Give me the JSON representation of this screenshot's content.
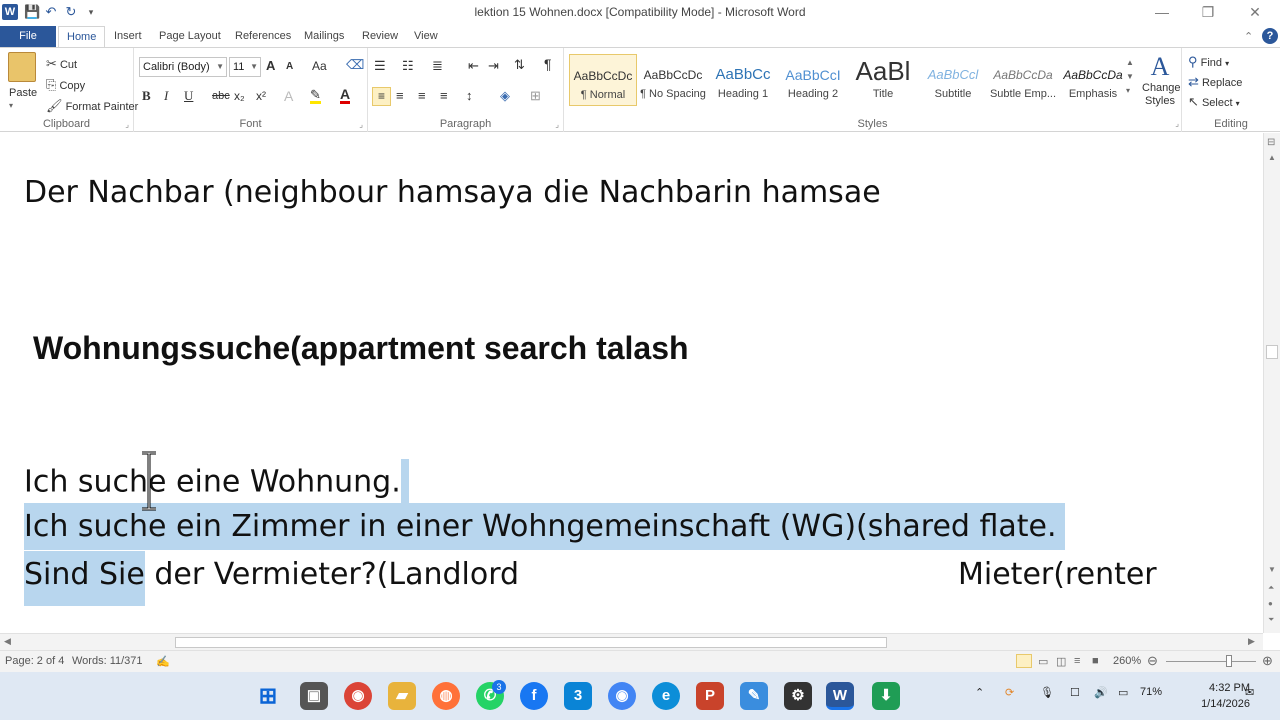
{
  "window": {
    "title": "lektion 15 Wohnen.docx [Compatibility Mode]  -  Microsoft Word",
    "minimize": "—",
    "restore": "❐",
    "close": "✕"
  },
  "tabs": [
    {
      "label": "File"
    },
    {
      "label": "Home"
    },
    {
      "label": "Insert"
    },
    {
      "label": "Page Layout"
    },
    {
      "label": "References"
    },
    {
      "label": "Mailings"
    },
    {
      "label": "Review"
    },
    {
      "label": "View"
    }
  ],
  "ribbon": {
    "clipboard": {
      "label": "Clipboard",
      "paste": "Paste",
      "cut": "Cut",
      "copy": "Copy",
      "format_painter": "Format Painter"
    },
    "font": {
      "label": "Font",
      "family": "Calibri (Body)",
      "size": "11",
      "bold": "B",
      "italic": "I",
      "underline": "U",
      "strike": "abc",
      "subscript": "x₂",
      "superscript": "x²",
      "grow": "A",
      "shrink": "A",
      "case": "Aa",
      "color_a": "A"
    },
    "paragraph": {
      "label": "Paragraph",
      "pilcrow": "¶"
    },
    "styles": {
      "label": "Styles",
      "items": [
        {
          "sample": "AaBbCcDc",
          "name": "¶ Normal"
        },
        {
          "sample": "AaBbCcDc",
          "name": "¶ No Spacing"
        },
        {
          "sample": "AaBbCc",
          "name": "Heading 1"
        },
        {
          "sample": "AaBbCcI",
          "name": "Heading 2"
        },
        {
          "sample": "AaBl",
          "name": "Title"
        },
        {
          "sample": "AaBbCcl",
          "name": "Subtitle"
        },
        {
          "sample": "AaBbCcDa",
          "name": "Subtle Emp..."
        },
        {
          "sample": "AaBbCcDa",
          "name": "Emphasis"
        }
      ],
      "change_styles": "Change Styles"
    },
    "editing": {
      "label": "Editing",
      "find": "Find",
      "replace": "Replace",
      "select": "Select"
    }
  },
  "document": {
    "line1": "Der Nachbar   (neighbour   hamsaya      die Nachbarin hamsae",
    "line2": "Wohnungssuche(appartment  search talash",
    "line3": "Ich suche eine Wohnung.",
    "line4": "Ich suche ein Zimmer in einer Wohngemeinschaft (WG)(shared  flate.",
    "line5_hl": "Sind Sie",
    "line5_rest": " der Vermieter?(Landlord",
    "line5_right": "Mieter(renter"
  },
  "status": {
    "page": "Page: 2 of 4",
    "words": "Words: 11/371",
    "zoom": "260%"
  },
  "tray": {
    "battery": "71%",
    "time": "4:32 PM",
    "date": "1/14/2026",
    "whatsapp_badge": "3"
  },
  "colors": {
    "accent": "#2b579a",
    "selection": "#b8d6ee",
    "taskbar": "#dfe8f3"
  }
}
